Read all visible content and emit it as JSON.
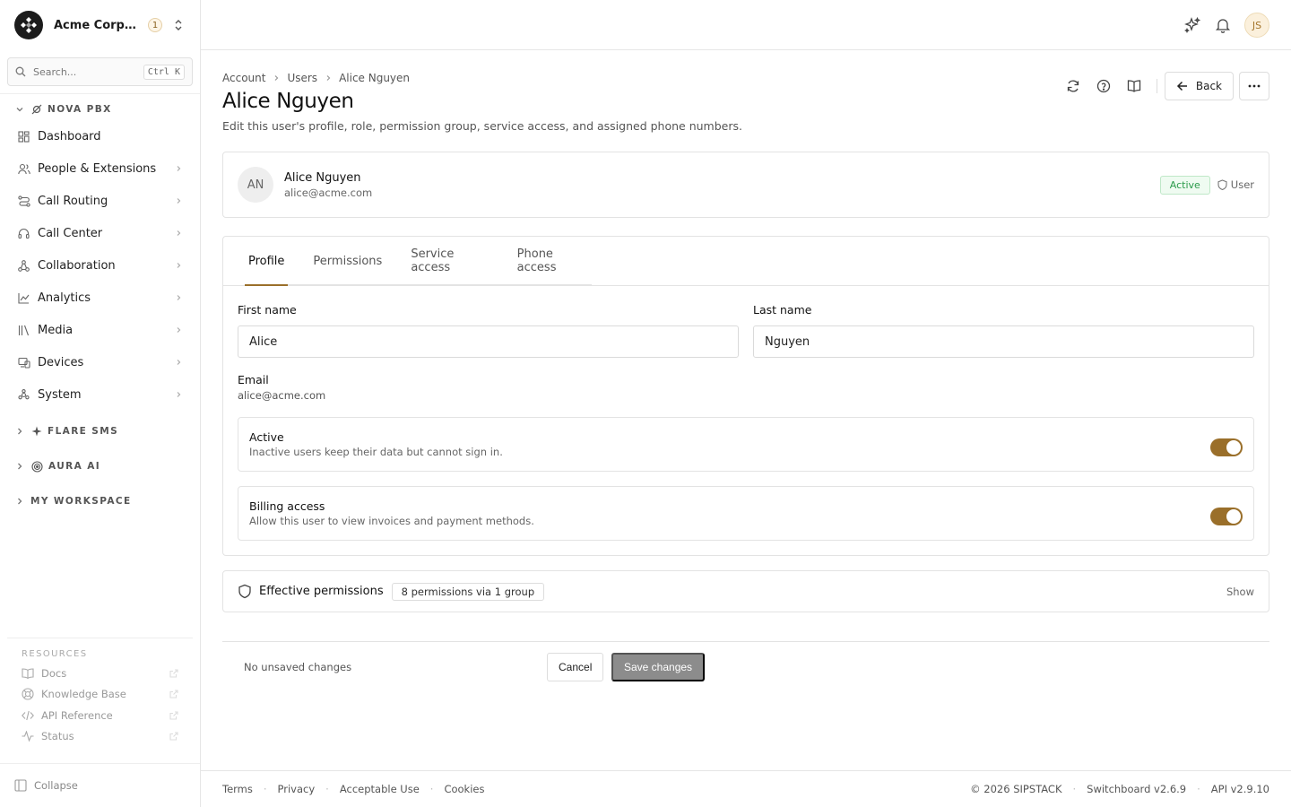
{
  "org": {
    "name": "Acme Corporation",
    "badge": "1"
  },
  "search": {
    "placeholder": "Search...",
    "shortcut": "Ctrl K"
  },
  "nav": {
    "sections": [
      {
        "label": "NOVA PBX",
        "icon": "nova-icon",
        "expanded": true
      },
      {
        "label": "FLARE SMS",
        "icon": "sparkle-icon",
        "expanded": false
      },
      {
        "label": "AURA AI",
        "icon": "aura-icon",
        "expanded": false
      },
      {
        "label": "MY WORKSPACE",
        "expanded": false
      }
    ],
    "items": [
      {
        "label": "Dashboard",
        "icon": "dashboard-icon"
      },
      {
        "label": "People & Extensions",
        "icon": "people-icon"
      },
      {
        "label": "Call Routing",
        "icon": "routing-icon"
      },
      {
        "label": "Call Center",
        "icon": "headset-icon"
      },
      {
        "label": "Collaboration",
        "icon": "collaboration-icon"
      },
      {
        "label": "Analytics",
        "icon": "analytics-icon"
      },
      {
        "label": "Media",
        "icon": "media-icon"
      },
      {
        "label": "Devices",
        "icon": "devices-icon"
      },
      {
        "label": "System",
        "icon": "system-icon"
      }
    ]
  },
  "resources": {
    "heading": "RESOURCES",
    "items": [
      {
        "label": "Docs",
        "icon": "book-icon"
      },
      {
        "label": "Knowledge Base",
        "icon": "lifebuoy-icon"
      },
      {
        "label": "API Reference",
        "icon": "code-icon"
      },
      {
        "label": "Status",
        "icon": "activity-icon"
      }
    ]
  },
  "collapse_label": "Collapse",
  "topbar": {
    "avatar_initials": "JS"
  },
  "breadcrumb": [
    "Account",
    "Users",
    "Alice Nguyen"
  ],
  "page": {
    "title": "Alice Nguyen",
    "subtitle": "Edit this user's profile, role, permission group, service access, and assigned phone numbers.",
    "back_label": "Back"
  },
  "user_card": {
    "initials": "AN",
    "name": "Alice Nguyen",
    "email": "alice@acme.com",
    "status": "Active",
    "role": "User"
  },
  "tabs": [
    "Profile",
    "Permissions",
    "Service access",
    "Phone access"
  ],
  "active_tab": "Profile",
  "form": {
    "first_name_label": "First name",
    "first_name_value": "Alice",
    "last_name_label": "Last name",
    "last_name_value": "Nguyen",
    "email_label": "Email",
    "email_value": "alice@acme.com",
    "active_title": "Active",
    "active_desc": "Inactive users keep their data but cannot sign in.",
    "active_on": true,
    "billing_title": "Billing access",
    "billing_desc": "Allow this user to view invoices and payment methods.",
    "billing_on": true
  },
  "permissions": {
    "title": "Effective permissions",
    "summary": "8 permissions via 1 group",
    "toggle_label": "Show"
  },
  "save_bar": {
    "status": "No unsaved changes",
    "cancel_label": "Cancel",
    "save_label": "Save changes"
  },
  "footer": {
    "links": [
      "Terms",
      "Privacy",
      "Acceptable Use",
      "Cookies"
    ],
    "copyright": "© 2026 SIPSTACK",
    "version": "Switchboard v2.6.9",
    "api_version": "API v2.9.10"
  },
  "colors": {
    "accent": "#9a6f2a",
    "active_badge": "#2a9a4a"
  }
}
